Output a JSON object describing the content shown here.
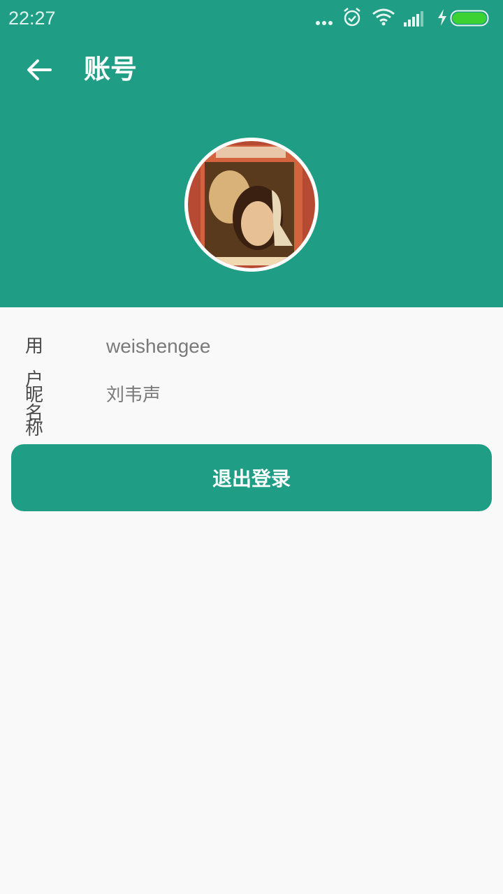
{
  "status_bar": {
    "time": "22:27",
    "icons": [
      "more-dots-icon",
      "alarm-icon",
      "wifi-icon",
      "signal-icon",
      "charging-bolt-icon",
      "battery-icon"
    ]
  },
  "appbar": {
    "title": "账号",
    "back_icon": "arrow-left-icon"
  },
  "profile": {
    "avatar": "album-cover-avatar",
    "username_label": "用户名",
    "username_value": "weishengee",
    "nickname_label": "昵称",
    "nickname_value": "刘韦声"
  },
  "actions": {
    "logout_label": "退出登录"
  },
  "colors": {
    "primary": "#209e85",
    "background": "#f9f9f9",
    "battery": "#3cd232"
  }
}
